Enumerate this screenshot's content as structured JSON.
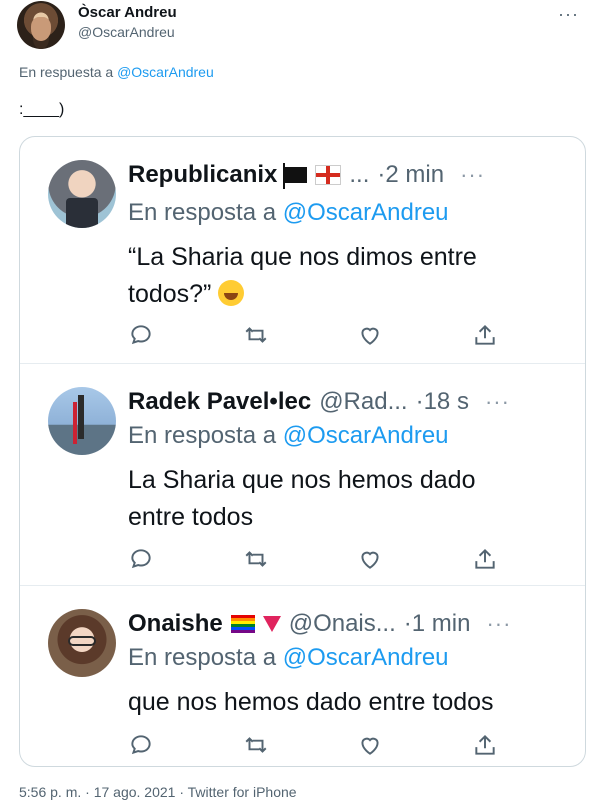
{
  "author": {
    "name": "Òscar Andreu",
    "handle": "@OscarAndreu"
  },
  "tweet": {
    "reply_prefix": "En respuesta a",
    "reply_mention": "@OscarAndreu",
    "text": ":____)"
  },
  "replies": [
    {
      "name": "Republicanix",
      "handle": "...",
      "time": "·2 min",
      "reply_prefix": "En resposta a",
      "reply_mention": "@OscarAndreu",
      "text_line1": "“La Sharia que nos dimos entre",
      "text_line2": "todos?”"
    },
    {
      "name": "Radek Pavel•lec",
      "handle": "@Rad...",
      "time": "·18 s",
      "reply_prefix": "En resposta a",
      "reply_mention": "@OscarAndreu",
      "text_line1": "La Sharia que nos hemos dado",
      "text_line2": "entre todos"
    },
    {
      "name": "Onaishe",
      "handle": "@Onais...",
      "time": "·1 min",
      "reply_prefix": "En resposta a",
      "reply_mention": "@OscarAndreu",
      "text_line1": "que nos hemos dado entre todos"
    }
  ],
  "footer": {
    "meta": "5:56 p. m. · 17 ago. 2021 · Twitter for iPhone"
  },
  "icons": [
    "reply-icon",
    "retweet-icon",
    "like-icon",
    "share-icon",
    "more-icon",
    "black-flag-icon",
    "georgia-flag-icon",
    "rainbow-flag-icon",
    "red-triangle-icon",
    "grinning-face-icon"
  ],
  "colors": {
    "accent": "#1d9bf0",
    "secondary_text": "#536471",
    "border": "#cfd9de"
  }
}
